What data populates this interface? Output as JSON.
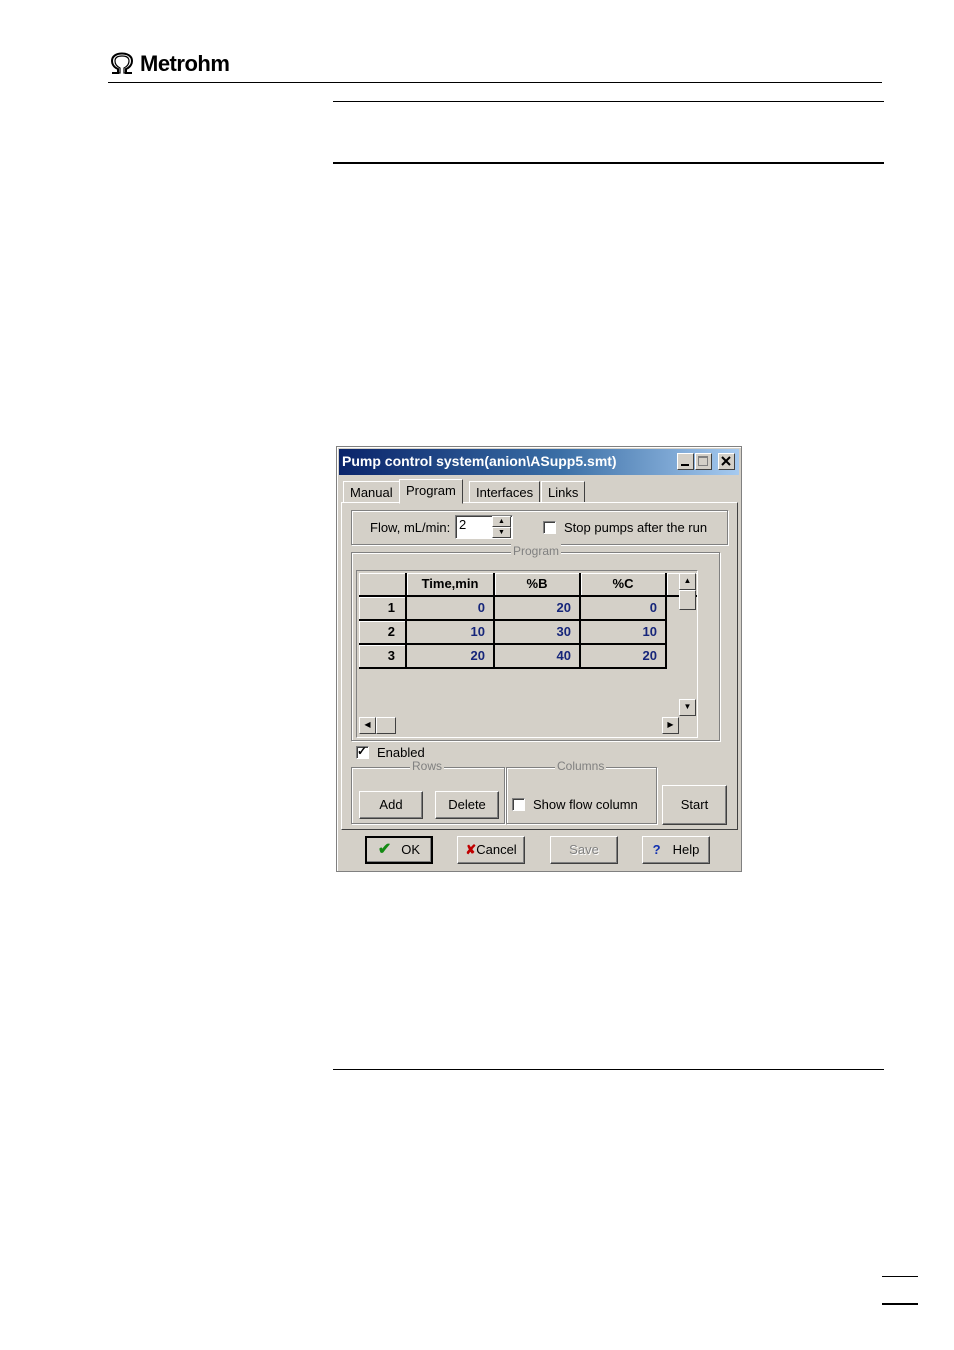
{
  "header": {
    "brand": "Metrohm"
  },
  "dialog": {
    "title": "Pump control system(anion\\ASupp5.smt)",
    "tabs": [
      "Manual",
      "Program",
      "Interfaces",
      "Links"
    ],
    "active_tab": "Program",
    "flow_label": "Flow, mL/min:",
    "flow_value": "2",
    "stop_pumps_label": "Stop pumps after the run",
    "stop_pumps_checked": false,
    "program_group": "Program",
    "grid": {
      "columns": [
        "Time,min",
        "%B",
        "%C"
      ],
      "rows": [
        {
          "index": "1",
          "cells": [
            "0",
            "20",
            "0"
          ]
        },
        {
          "index": "2",
          "cells": [
            "10",
            "30",
            "10"
          ]
        },
        {
          "index": "3",
          "cells": [
            "20",
            "40",
            "20"
          ]
        }
      ]
    },
    "enabled_label": "Enabled",
    "enabled_checked": true,
    "rows_group": "Rows",
    "add_label": "Add",
    "delete_label": "Delete",
    "columns_group": "Columns",
    "show_flow_label": "Show flow column",
    "show_flow_checked": false,
    "start_label": "Start",
    "ok_label": "OK",
    "cancel_label": "Cancel",
    "save_label": "Save",
    "help_label": "Help"
  },
  "colors": {
    "title_start": "#0a246a",
    "title_end": "#a6caf0",
    "face": "#d4d0c8",
    "cell_value": "#16267a",
    "ok_check": "#138a13",
    "cancel_x": "#c00000",
    "help_q": "#1030b0"
  },
  "icons": [
    "omega-logo-icon",
    "minimize-icon",
    "maximize-icon",
    "close-icon",
    "checkmark-icon",
    "cross-icon",
    "question-icon",
    "arrow-up-icon",
    "arrow-down-icon",
    "arrow-left-icon",
    "arrow-right-icon"
  ]
}
